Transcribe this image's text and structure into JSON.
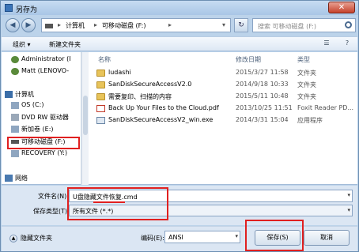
{
  "window": {
    "title": "另存为",
    "close_label": "✕"
  },
  "address": {
    "crumbs": [
      "计算机",
      "可移动磁盘 (F:)"
    ],
    "arrow": "▸",
    "search_placeholder": "搜索 可移动磁盘 (F:)"
  },
  "toolbar": {
    "organize": "组织 ▾",
    "new_folder": "新建文件夹"
  },
  "nav": [
    {
      "label": "Administrator (I",
      "icon": "user-icon"
    },
    {
      "label": "Matt (LENOVO-",
      "icon": "user-icon"
    },
    {
      "label": "计算机",
      "icon": "computer-icon"
    },
    {
      "label": "OS (C:)",
      "icon": "drive-icon"
    },
    {
      "label": "DVD RW 驱动器",
      "icon": "dvd-drive-icon"
    },
    {
      "label": "新加卷 (E:)",
      "icon": "drive-icon"
    },
    {
      "label": "可移动磁盘 (F:)",
      "icon": "usb-drive-icon"
    },
    {
      "label": "RECOVERY (Y:)",
      "icon": "drive-icon"
    },
    {
      "label": "网络",
      "icon": "network-icon"
    }
  ],
  "columns": {
    "name": "名称",
    "date": "修改日期",
    "type": "类型"
  },
  "files": [
    {
      "name": "ludashi",
      "date": "2015/3/27 11:58",
      "type": "文件夹",
      "kind": "folder"
    },
    {
      "name": "SanDiskSecureAccessV2.0",
      "date": "2014/9/18 10:33",
      "type": "文件夹",
      "kind": "folder"
    },
    {
      "name": "需要复印、扫描的内容",
      "date": "2015/5/11 10:48",
      "type": "文件夹",
      "kind": "folder"
    },
    {
      "name": "Back Up Your Files to the Cloud.pdf",
      "date": "2013/10/25 11:51",
      "type": "Foxit Reader PD...",
      "kind": "pdf"
    },
    {
      "name": "SanDiskSecureAccessV2_win.exe",
      "date": "2014/3/31 15:04",
      "type": "应用程序",
      "kind": "exe"
    }
  ],
  "form": {
    "filename_label": "文件名(N):",
    "filename_value": "U盘隐藏文件恢复.cmd",
    "filetype_label": "保存类型(T):",
    "filetype_value": "所有文件  (*.*)"
  },
  "footer": {
    "hide_folders": "隐藏文件夹",
    "encoding_label": "编码(E):",
    "encoding_value": "ANSI",
    "save": "保存(S)",
    "cancel": "取消"
  },
  "colors": {
    "highlight": "#e02020",
    "chrome": "#bcd3ea"
  }
}
